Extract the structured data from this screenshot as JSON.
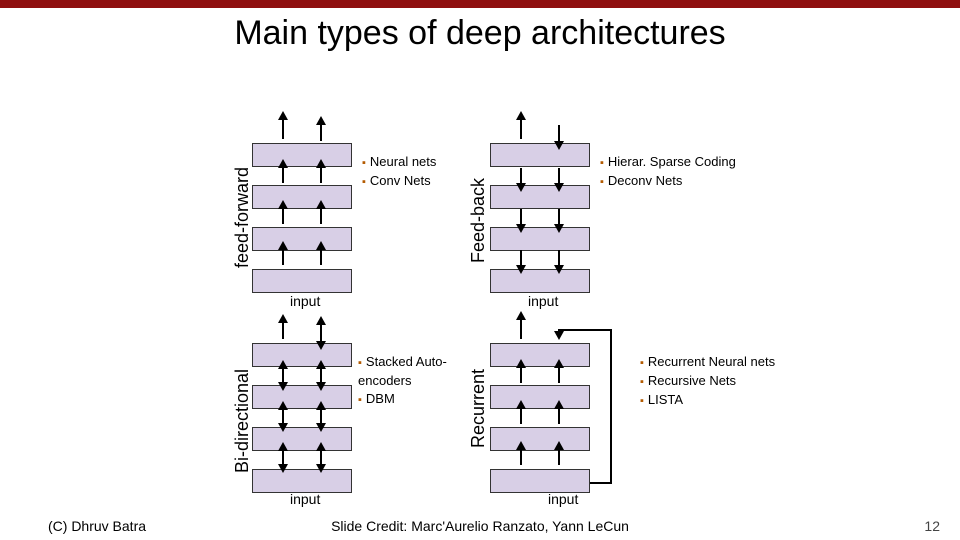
{
  "title": "Main types of deep architectures",
  "labels": {
    "feedforward": "feed-forward",
    "feedback": "Feed-back",
    "bidirectional": "Bi-directional",
    "recurrent": "Recurrent"
  },
  "bullets": {
    "ff": [
      "Neural nets",
      "Conv Nets"
    ],
    "fb": [
      "Hierar. Sparse Coding",
      "Deconv Nets"
    ],
    "bd": [
      "Stacked Auto-encoders",
      "DBM"
    ],
    "rc": [
      "Recurrent Neural nets",
      "Recursive Nets",
      "LISTA"
    ]
  },
  "input_label": "input",
  "footer": {
    "left": "(C) Dhruv Batra",
    "center": "Slide Credit: Marc'Aurelio Ranzato, Yann LeCun",
    "page": "12"
  }
}
